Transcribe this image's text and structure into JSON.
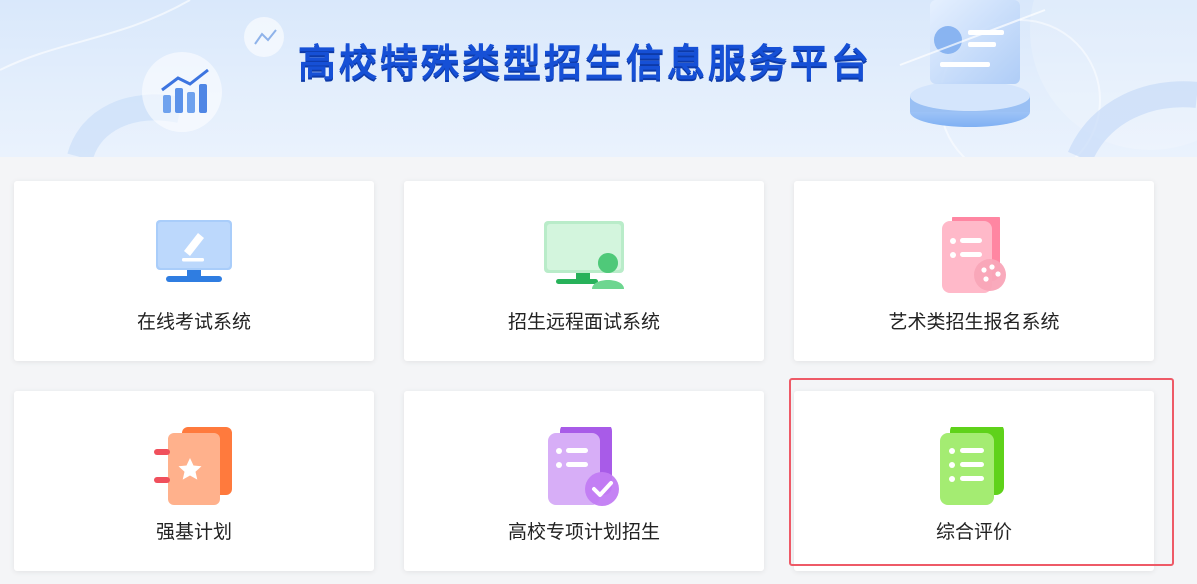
{
  "banner": {
    "title": "高校特殊类型招生信息服务平台"
  },
  "cards": [
    {
      "label": "在线考试系统",
      "icon": "monitor-pen-icon",
      "color": "#2f7de1"
    },
    {
      "label": "招生远程面试系统",
      "icon": "monitor-user-icon",
      "color": "#3cc06a"
    },
    {
      "label": "艺术类招生报名系统",
      "icon": "palette-document-icon",
      "color": "#f2718f"
    },
    {
      "label": "强基计划",
      "icon": "star-notebook-icon",
      "color": "#ff7a3d"
    },
    {
      "label": "高校专项计划招生",
      "icon": "checklist-document-icon",
      "color": "#a85be8"
    },
    {
      "label": "综合评价",
      "icon": "list-document-icon",
      "color": "#5fd21a"
    }
  ],
  "highlight_color": "#ee5a67"
}
